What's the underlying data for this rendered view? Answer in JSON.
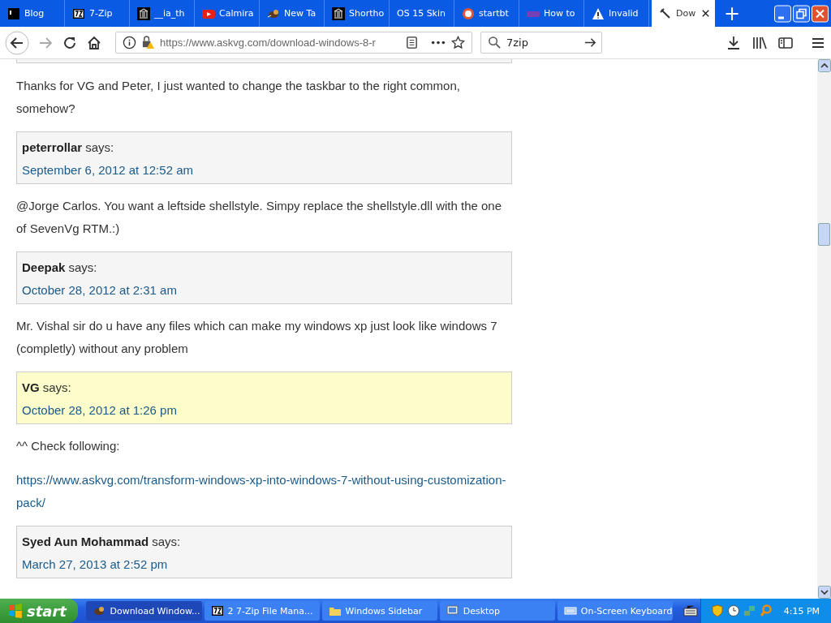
{
  "tabs": [
    {
      "label": "Blog",
      "kind": "square",
      "selected": false
    },
    {
      "label": "7-Zip",
      "kind": "archive",
      "selected": false
    },
    {
      "label": "__ia_th",
      "kind": "museum",
      "selected": false
    },
    {
      "label": "Calmira",
      "kind": "play",
      "selected": false
    },
    {
      "label": "New Ta",
      "kind": "bird",
      "selected": false
    },
    {
      "label": "Shortho",
      "kind": "museum",
      "selected": false
    },
    {
      "label": "OS 15 Skin",
      "kind": "plain",
      "selected": false
    },
    {
      "label": "startbt",
      "kind": "circle",
      "selected": false
    },
    {
      "label": "How to",
      "kind": "gk",
      "selected": false
    },
    {
      "label": "Invalid",
      "kind": "warning",
      "selected": false
    },
    {
      "label": "Dow",
      "kind": "hammer",
      "selected": true
    }
  ],
  "new_tab": "+",
  "url": "https://www.askvg.com/download-windows-8-r",
  "search": {
    "value": "7zip"
  },
  "comments": [
    {
      "kind": "top"
    },
    {
      "kind": "text",
      "text": "Thanks for VG and Peter, I just wanted to change the taskbar to the right common, somehow?"
    },
    {
      "kind": "meta",
      "author": "peterrollar",
      "says": "says:",
      "date": "September 6, 2012 at 12:52 am",
      "highlighted": false
    },
    {
      "kind": "text",
      "text": "@Jorge Carlos. You want a leftside shellstyle. Simpy replace the shellstyle.dll with the one of SevenVg RTM.:)"
    },
    {
      "kind": "meta",
      "author": "Deepak",
      "says": "says:",
      "date": "October 28, 2012 at 2:31 am",
      "highlighted": false
    },
    {
      "kind": "text",
      "text": "Mr. Vishal sir do u have any files which can make my windows xp just look like windows 7 (completly) without any problem"
    },
    {
      "kind": "meta",
      "author": "VG",
      "says": "says:",
      "date": "October 28, 2012 at 1:26 pm",
      "highlighted": true
    },
    {
      "kind": "text",
      "text": "^^ Check following:"
    },
    {
      "kind": "link",
      "text": "https://www.askvg.com/transform-windows-xp-into-windows-7-without-using-customization-pack/"
    },
    {
      "kind": "meta",
      "author": "Syed Aun Mohammad",
      "says": "says:",
      "date": "March 27, 2013 at 2:52 pm",
      "highlighted": false
    }
  ],
  "taskbar": {
    "start": "start",
    "tasks": [
      {
        "label": "Download Window...",
        "kind": "bird",
        "selected": true
      },
      {
        "label": "2  7-Zip File Mana...",
        "kind": "archive",
        "selected": false
      },
      {
        "label": "Windows Sidebar",
        "kind": "folder",
        "selected": false
      },
      {
        "label": "Desktop",
        "kind": "desktop",
        "selected": false
      },
      {
        "label": "On-Screen Keyboard",
        "kind": "keyboard",
        "selected": false
      }
    ],
    "clock": "4:15 PM"
  }
}
